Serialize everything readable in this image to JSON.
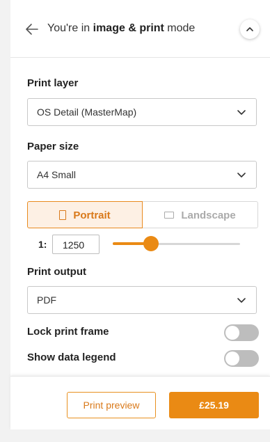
{
  "header": {
    "prefix": "You're in ",
    "mode_bold": "image & print",
    "suffix": " mode"
  },
  "print_layer": {
    "label": "Print layer",
    "selected": "OS Detail (MasterMap)"
  },
  "paper_size": {
    "label": "Paper size",
    "selected": "A4 Small"
  },
  "orientation": {
    "portrait_label": "Portrait",
    "landscape_label": "Landscape",
    "selected": "Portrait"
  },
  "scale": {
    "prefix": "1:",
    "value": "1250",
    "slider_level": 0.3
  },
  "print_output": {
    "label": "Print output",
    "selected": "PDF"
  },
  "toggles": {
    "lock_print_frame": {
      "label": "Lock print frame",
      "on": false
    },
    "show_data_legend": {
      "label": "Show data legend",
      "on": false
    }
  },
  "footer": {
    "preview_label": "Print preview",
    "price_label": "£25.19"
  },
  "colors": {
    "accent": "#ea8a14",
    "accent_text": "#d9791a",
    "toggle_off": "#bdbdbd"
  },
  "icons": {
    "back": "arrow-left-icon",
    "collapse": "chevron-up-icon",
    "dropdown": "chevron-down-icon",
    "portrait": "portrait-page-icon",
    "landscape": "landscape-page-icon"
  }
}
